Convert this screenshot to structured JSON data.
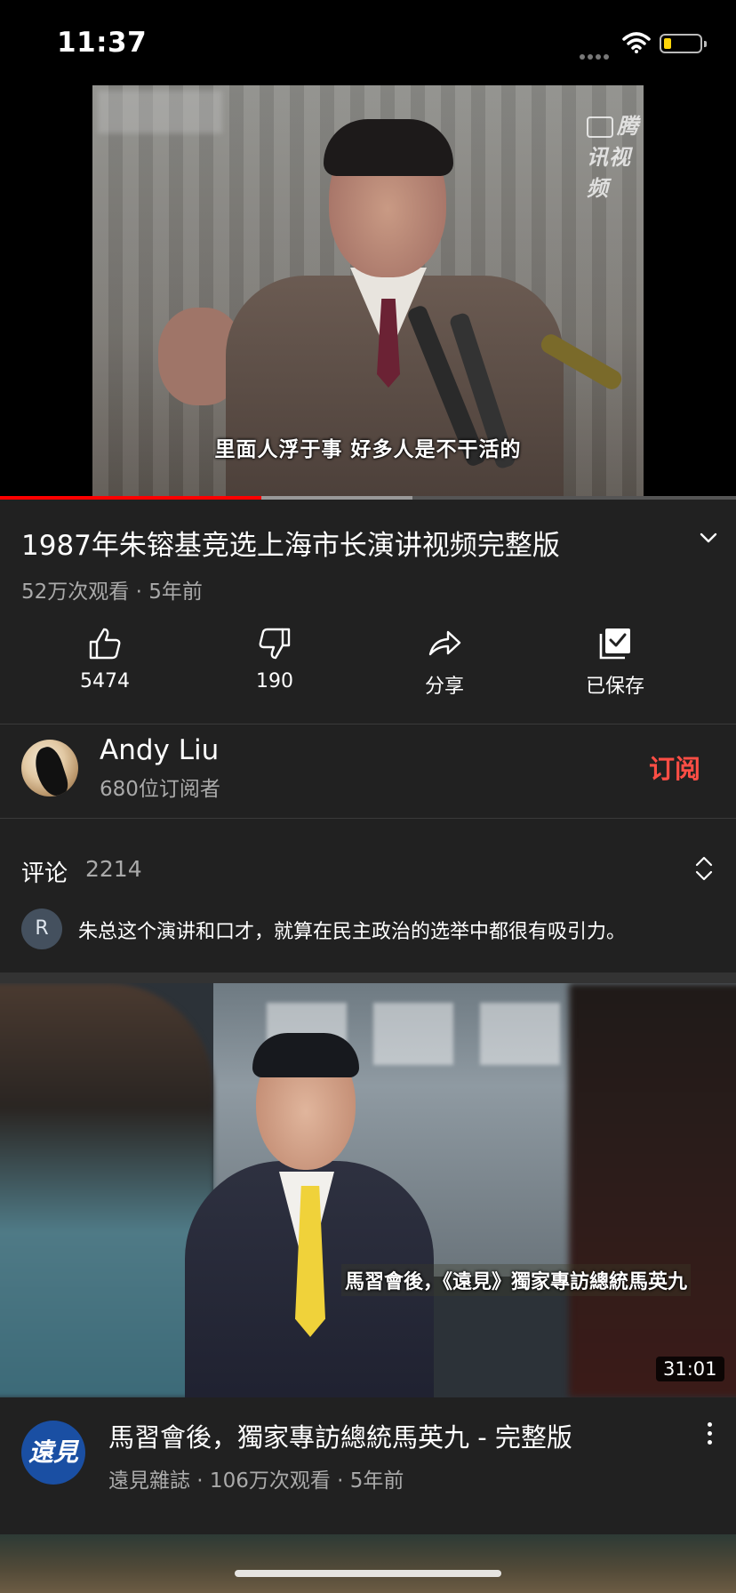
{
  "status_bar": {
    "time": "11:37"
  },
  "video": {
    "watermark": "腾讯视频",
    "subtitle": "里面人浮于事 好多人是不干活的",
    "progress_fraction": 0.355,
    "buffered_fraction": 0.56,
    "title": "1987年朱镕基竞选上海市长演讲视频完整版",
    "meta": "52万次观看 · 5年前"
  },
  "actions": {
    "like_count": "5474",
    "dislike_count": "190",
    "share_label": "分享",
    "save_label": "已保存"
  },
  "channel": {
    "name": "Andy Liu",
    "subscribers": "680位订阅者",
    "subscribe_label": "订阅"
  },
  "comments": {
    "label": "评论",
    "count": "2214",
    "top_comment_initial": "R",
    "top_comment": "朱总这个演讲和口才，就算在民主政治的选举中都很有吸引力。"
  },
  "recommended": {
    "thumbnail_caption": "馬習會後，《遠見》獨家專訪總統馬英九",
    "duration": "31:01",
    "channel_logo_text": "遠見",
    "title": "馬習會後，獨家專訪總統馬英九 - 完整版",
    "meta": "遠見雜誌 · 106万次观看 · 5年前"
  },
  "colors": {
    "background": "#212121",
    "accent": "#ff0000",
    "subscribe": "#ff4e45",
    "secondary_text": "#aaaaaa"
  },
  "icons": [
    "wifi-icon",
    "battery-icon",
    "chevron-down-icon",
    "thumbs-up-icon",
    "thumbs-down-icon",
    "share-icon",
    "saved-icon",
    "expand-collapse-icon",
    "more-vert-icon"
  ]
}
